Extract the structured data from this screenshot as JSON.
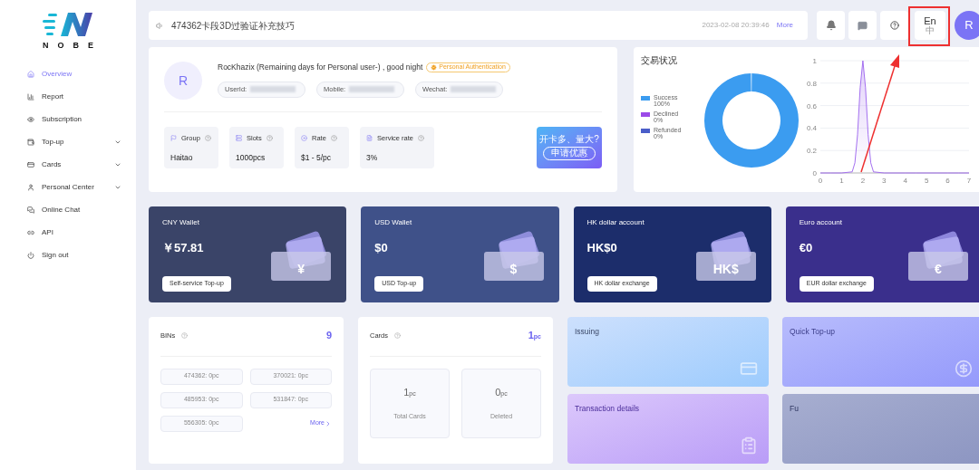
{
  "sidebar": {
    "logo_text": "NOBE",
    "items": [
      {
        "label": "Overview",
        "selected": true,
        "expandable": false
      },
      {
        "label": "Report",
        "selected": false,
        "expandable": false
      },
      {
        "label": "Subscription",
        "selected": false,
        "expandable": false
      },
      {
        "label": "Top-up",
        "selected": false,
        "expandable": true
      },
      {
        "label": "Cards",
        "selected": false,
        "expandable": true
      },
      {
        "label": "Personal Center",
        "selected": false,
        "expandable": true
      },
      {
        "label": "Online Chat",
        "selected": false,
        "expandable": false
      },
      {
        "label": "API",
        "selected": false,
        "expandable": false
      },
      {
        "label": "Sign out",
        "selected": false,
        "expandable": false
      }
    ]
  },
  "notice": {
    "text": "474362卡段3D过验证补充技巧",
    "time": "2023-02-08 20:39:46",
    "more": "More"
  },
  "header": {
    "lang_primary": "En",
    "lang_secondary": "中",
    "avatar": "R",
    "highlighted": true
  },
  "profile": {
    "avatar": "R",
    "greeting": "RocKhazix (Remaining days for Personal user-) , good night",
    "badge": "Personal Authentication",
    "fields": [
      "UserId:",
      "Mobile:",
      "Wechat:"
    ],
    "stats": [
      {
        "label": "Group",
        "value": "Haitao"
      },
      {
        "label": "Slots",
        "value": "1000pcs"
      },
      {
        "label": "Rate",
        "value": "$1 - 5/pc"
      },
      {
        "label": "Service rate",
        "value": "3%"
      }
    ],
    "promo": {
      "title": "开卡多、量大?",
      "button": "申请优惠"
    }
  },
  "status_chart": {
    "title": "交易状况",
    "legend": [
      {
        "percent": "100%",
        "color": "#3b9cf0"
      },
      {
        "percent": "0%",
        "color": "#9b4ae8"
      },
      {
        "percent": "0%",
        "color": "#4a5ec9"
      }
    ],
    "chart_data": {
      "type": "donut",
      "categories": [
        "Success",
        "Declined",
        "Refunded"
      ],
      "values": [
        100,
        0,
        0
      ]
    }
  },
  "trend_chart": {
    "chart_data": {
      "type": "line",
      "x": [
        0,
        0.5,
        1,
        1.5,
        1.625,
        1.75,
        1.875,
        2,
        2.125,
        2.25,
        2.375,
        2.5,
        3,
        3.5,
        4,
        4.5,
        5,
        5.5,
        6,
        6.5,
        7
      ],
      "series": [
        {
          "color": "#a470f0",
          "values": [
            0,
            0,
            0,
            0.01,
            0.09,
            0.34,
            0.76,
            1,
            0.76,
            0.34,
            0.09,
            0.01,
            0,
            0,
            0,
            0,
            0,
            0,
            0,
            0,
            0
          ]
        }
      ],
      "xlim": [
        0,
        7
      ],
      "ylim": [
        0,
        1
      ],
      "xticks": [
        0,
        1,
        2,
        3,
        4,
        5,
        6,
        7
      ],
      "yticks": [
        0,
        0.2,
        0.4,
        0.6,
        0.8,
        1
      ],
      "grid": true
    }
  },
  "wallets": [
    {
      "title": "CNY Wallet",
      "amount": "￥57.81",
      "symbol": "¥",
      "button": "Self-service Top-up",
      "color": "#3a4468"
    },
    {
      "title": "USD Wallet",
      "amount": "$0",
      "symbol": "$",
      "button": "USD Top-up",
      "color": "#3f5189"
    },
    {
      "title": "HK dollar account",
      "amount": "HK$0",
      "symbol": "HK$",
      "button": "HK dollar exchange",
      "color": "#1c2d6b"
    },
    {
      "title": "Euro account",
      "amount": "€0",
      "symbol": "€",
      "button": "EUR dollar exchange",
      "color": "#3a2f8c"
    }
  ],
  "bins": {
    "title": "BINs",
    "count": "9",
    "items": [
      "474362: 0pc",
      "370021: 0pc",
      "485953: 0pc",
      "531847: 0pc",
      "556305: 0pc"
    ],
    "more": "More"
  },
  "cards": {
    "title": "Cards",
    "count": "1",
    "unit": "pc",
    "stats": [
      {
        "value": "1",
        "unit": "pc",
        "label": "Total Cards"
      },
      {
        "value": "0",
        "unit": "pc",
        "label": "Deleted"
      }
    ]
  },
  "tiles": [
    {
      "title": "Issuing"
    },
    {
      "title": "Quick Top-up"
    },
    {
      "title": "Transaction details"
    },
    {
      "title": "Fu"
    }
  ]
}
